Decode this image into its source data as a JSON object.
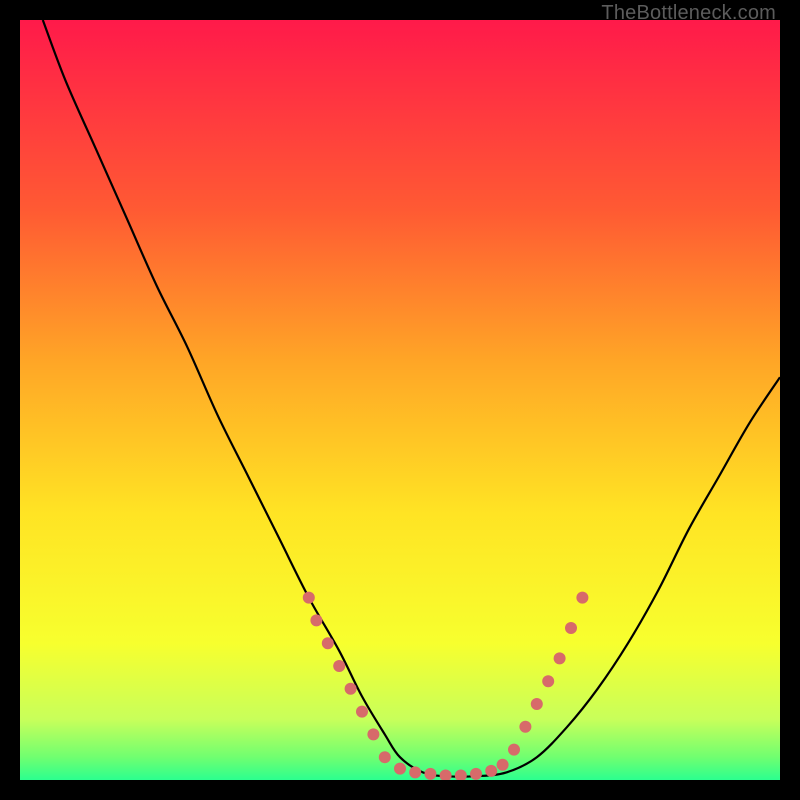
{
  "watermark": "TheBottleneck.com",
  "chart_data": {
    "type": "line",
    "title": "",
    "xlabel": "",
    "ylabel": "",
    "xlim": [
      0,
      100
    ],
    "ylim": [
      0,
      100
    ],
    "grid": false,
    "background_gradient": {
      "direction": "vertical",
      "stops": [
        {
          "pos": 0.0,
          "color": "#ff1a4a"
        },
        {
          "pos": 0.25,
          "color": "#ff5a33"
        },
        {
          "pos": 0.45,
          "color": "#ffa626"
        },
        {
          "pos": 0.65,
          "color": "#ffe424"
        },
        {
          "pos": 0.82,
          "color": "#f7ff2e"
        },
        {
          "pos": 0.92,
          "color": "#c8ff5a"
        },
        {
          "pos": 0.97,
          "color": "#70ff70"
        },
        {
          "pos": 1.0,
          "color": "#2bff8f"
        }
      ]
    },
    "series": [
      {
        "name": "bottleneck-curve",
        "color": "#000000",
        "x": [
          3,
          6,
          10,
          14,
          18,
          22,
          26,
          30,
          34,
          38,
          42,
          45,
          48,
          50,
          53,
          56,
          60,
          64,
          68,
          72,
          76,
          80,
          84,
          88,
          92,
          96,
          100
        ],
        "y": [
          100,
          92,
          83,
          74,
          65,
          57,
          48,
          40,
          32,
          24,
          17,
          11,
          6,
          3,
          1,
          0.5,
          0.5,
          1,
          3,
          7,
          12,
          18,
          25,
          33,
          40,
          47,
          53
        ]
      }
    ],
    "markers": [
      {
        "name": "highlight-dots-left",
        "color": "#d76a6a",
        "radius": 6,
        "points": [
          {
            "x": 38,
            "y": 24
          },
          {
            "x": 39,
            "y": 21
          },
          {
            "x": 40.5,
            "y": 18
          },
          {
            "x": 42,
            "y": 15
          },
          {
            "x": 43.5,
            "y": 12
          },
          {
            "x": 45,
            "y": 9
          },
          {
            "x": 46.5,
            "y": 6
          }
        ]
      },
      {
        "name": "highlight-dots-bottom",
        "color": "#d76a6a",
        "radius": 6,
        "points": [
          {
            "x": 48,
            "y": 3
          },
          {
            "x": 50,
            "y": 1.5
          },
          {
            "x": 52,
            "y": 1
          },
          {
            "x": 54,
            "y": 0.8
          },
          {
            "x": 56,
            "y": 0.6
          },
          {
            "x": 58,
            "y": 0.6
          },
          {
            "x": 60,
            "y": 0.8
          },
          {
            "x": 62,
            "y": 1.2
          },
          {
            "x": 63.5,
            "y": 2
          }
        ]
      },
      {
        "name": "highlight-dots-right",
        "color": "#d76a6a",
        "radius": 6,
        "points": [
          {
            "x": 65,
            "y": 4
          },
          {
            "x": 66.5,
            "y": 7
          },
          {
            "x": 68,
            "y": 10
          },
          {
            "x": 69.5,
            "y": 13
          },
          {
            "x": 71,
            "y": 16
          },
          {
            "x": 72.5,
            "y": 20
          },
          {
            "x": 74,
            "y": 24
          }
        ]
      }
    ]
  }
}
